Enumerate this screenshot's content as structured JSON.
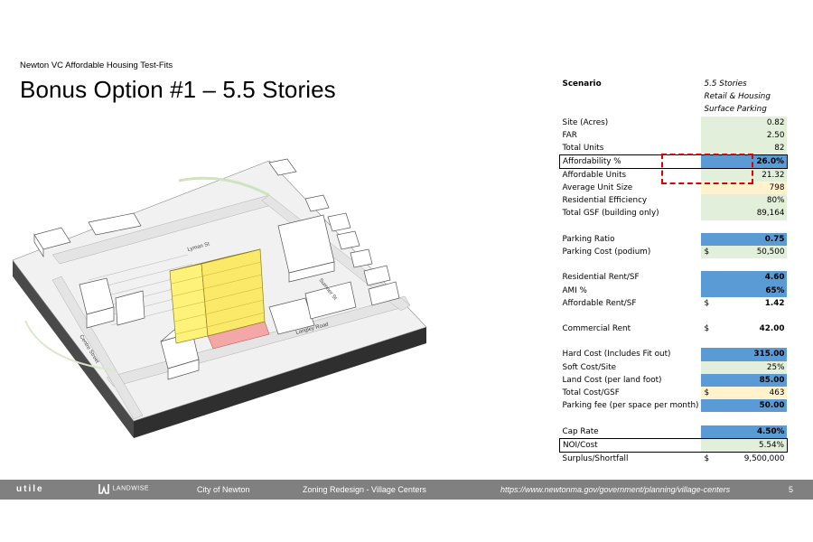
{
  "slide": {
    "subtitle": "Newton VC Affordable Housing Test-Fits",
    "title": "Bonus Option #1 – 5.5 Stories"
  },
  "map_labels": {
    "lyman": "Lyman St",
    "sumner": "Sumner St",
    "langley": "Langley Road",
    "centre": "Centre Street"
  },
  "colors": {
    "blue": "#5b9bd5",
    "green": "#e2efda",
    "yellow": "#fff2cc",
    "highlight_dash": "#e00000",
    "building_yellow": "#fff27a",
    "footer": "#808080"
  },
  "table": {
    "rows": [
      {
        "label": "Scenario",
        "prefix": "",
        "value": "5.5 Stories",
        "label_style": "bold",
        "value_style": "italic",
        "fill": "white"
      },
      {
        "label": "",
        "prefix": "",
        "value": "Retail & Housing",
        "value_style": "italic",
        "fill": "white"
      },
      {
        "label": "",
        "prefix": "",
        "value": "Surface Parking",
        "value_style": "italic",
        "fill": "white"
      },
      {
        "label": "Site (Acres)",
        "prefix": "",
        "value": "0.82",
        "fill": "green",
        "align": "right"
      },
      {
        "label": "FAR",
        "prefix": "",
        "value": "2.50",
        "fill": "green",
        "align": "right"
      },
      {
        "label": "Total Units",
        "prefix": "",
        "value": "82",
        "fill": "green",
        "align": "right"
      },
      {
        "label": "Affordability %",
        "prefix": "",
        "value": "26.0%",
        "fill": "blue",
        "align": "right",
        "value_style": "bold",
        "outline": true
      },
      {
        "label": "Affordable Units",
        "prefix": "",
        "value": "21.32",
        "fill": "green",
        "align": "right"
      },
      {
        "label": "Average Unit Size",
        "prefix": "",
        "value": "798",
        "fill": "yellow",
        "align": "right"
      },
      {
        "label": "Residential Efficiency",
        "prefix": "",
        "value": "80%",
        "fill": "green",
        "align": "right"
      },
      {
        "label": "Total GSF (building only)",
        "prefix": "",
        "value": "89,164",
        "fill": "green",
        "align": "right"
      },
      {
        "spacer": true
      },
      {
        "label": "Parking Ratio",
        "prefix": "",
        "value": "0.75",
        "fill": "blue",
        "align": "right",
        "value_style": "bold"
      },
      {
        "label": "Parking Cost (podium)",
        "prefix": "$",
        "value": "50,500",
        "fill": "green",
        "align": "right"
      },
      {
        "spacer": true
      },
      {
        "label": "Residential Rent/SF",
        "prefix": "",
        "value": "4.60",
        "fill": "blue",
        "align": "right",
        "value_style": "bold"
      },
      {
        "label": "AMI %",
        "prefix": "",
        "value": "65%",
        "fill": "blue",
        "align": "right",
        "value_style": "bold"
      },
      {
        "label": "Affordable Rent/SF",
        "prefix": "$",
        "value": "1.42",
        "fill": "white",
        "align": "right",
        "value_style": "bold"
      },
      {
        "spacer": true
      },
      {
        "label": "Commercial Rent",
        "prefix": "$",
        "value": "42.00",
        "fill": "white",
        "align": "right",
        "value_style": "bold"
      },
      {
        "spacer": true
      },
      {
        "label": "Hard Cost (Includes Fit out)",
        "prefix": "",
        "value": "315.00",
        "fill": "blue",
        "align": "right",
        "value_style": "bold"
      },
      {
        "label": "Soft Cost/Site",
        "prefix": "",
        "value": "25%",
        "fill": "green",
        "align": "right"
      },
      {
        "label": "Land Cost (per land foot)",
        "prefix": "",
        "value": "85.00",
        "fill": "blue",
        "align": "right",
        "value_style": "bold"
      },
      {
        "label": "Total Cost/GSF",
        "prefix": "$",
        "value": "463",
        "fill": "yellow",
        "align": "right"
      },
      {
        "label": "Parking fee (per space per month)",
        "prefix": "",
        "value": "50.00",
        "fill": "blue",
        "align": "right",
        "value_style": "bold"
      },
      {
        "spacer": true
      },
      {
        "label": "Cap Rate",
        "prefix": "",
        "value": "4.50%",
        "fill": "blue",
        "align": "right",
        "value_style": "bold"
      },
      {
        "label": "NOI/Cost",
        "prefix": "",
        "value": "5.54%",
        "fill": "green",
        "align": "right",
        "outline": true
      },
      {
        "label": "Surplus/Shortfall",
        "prefix": "$",
        "value": "9,500,000",
        "fill": "white",
        "align": "right"
      }
    ]
  },
  "footer": {
    "utile": "utile",
    "landwise": "LANDWISE",
    "city": "City of Newton",
    "project": "Zoning Redesign - Village Centers",
    "url": "https://www.newtonma.gov/government/planning/village-centers",
    "page": "5"
  }
}
